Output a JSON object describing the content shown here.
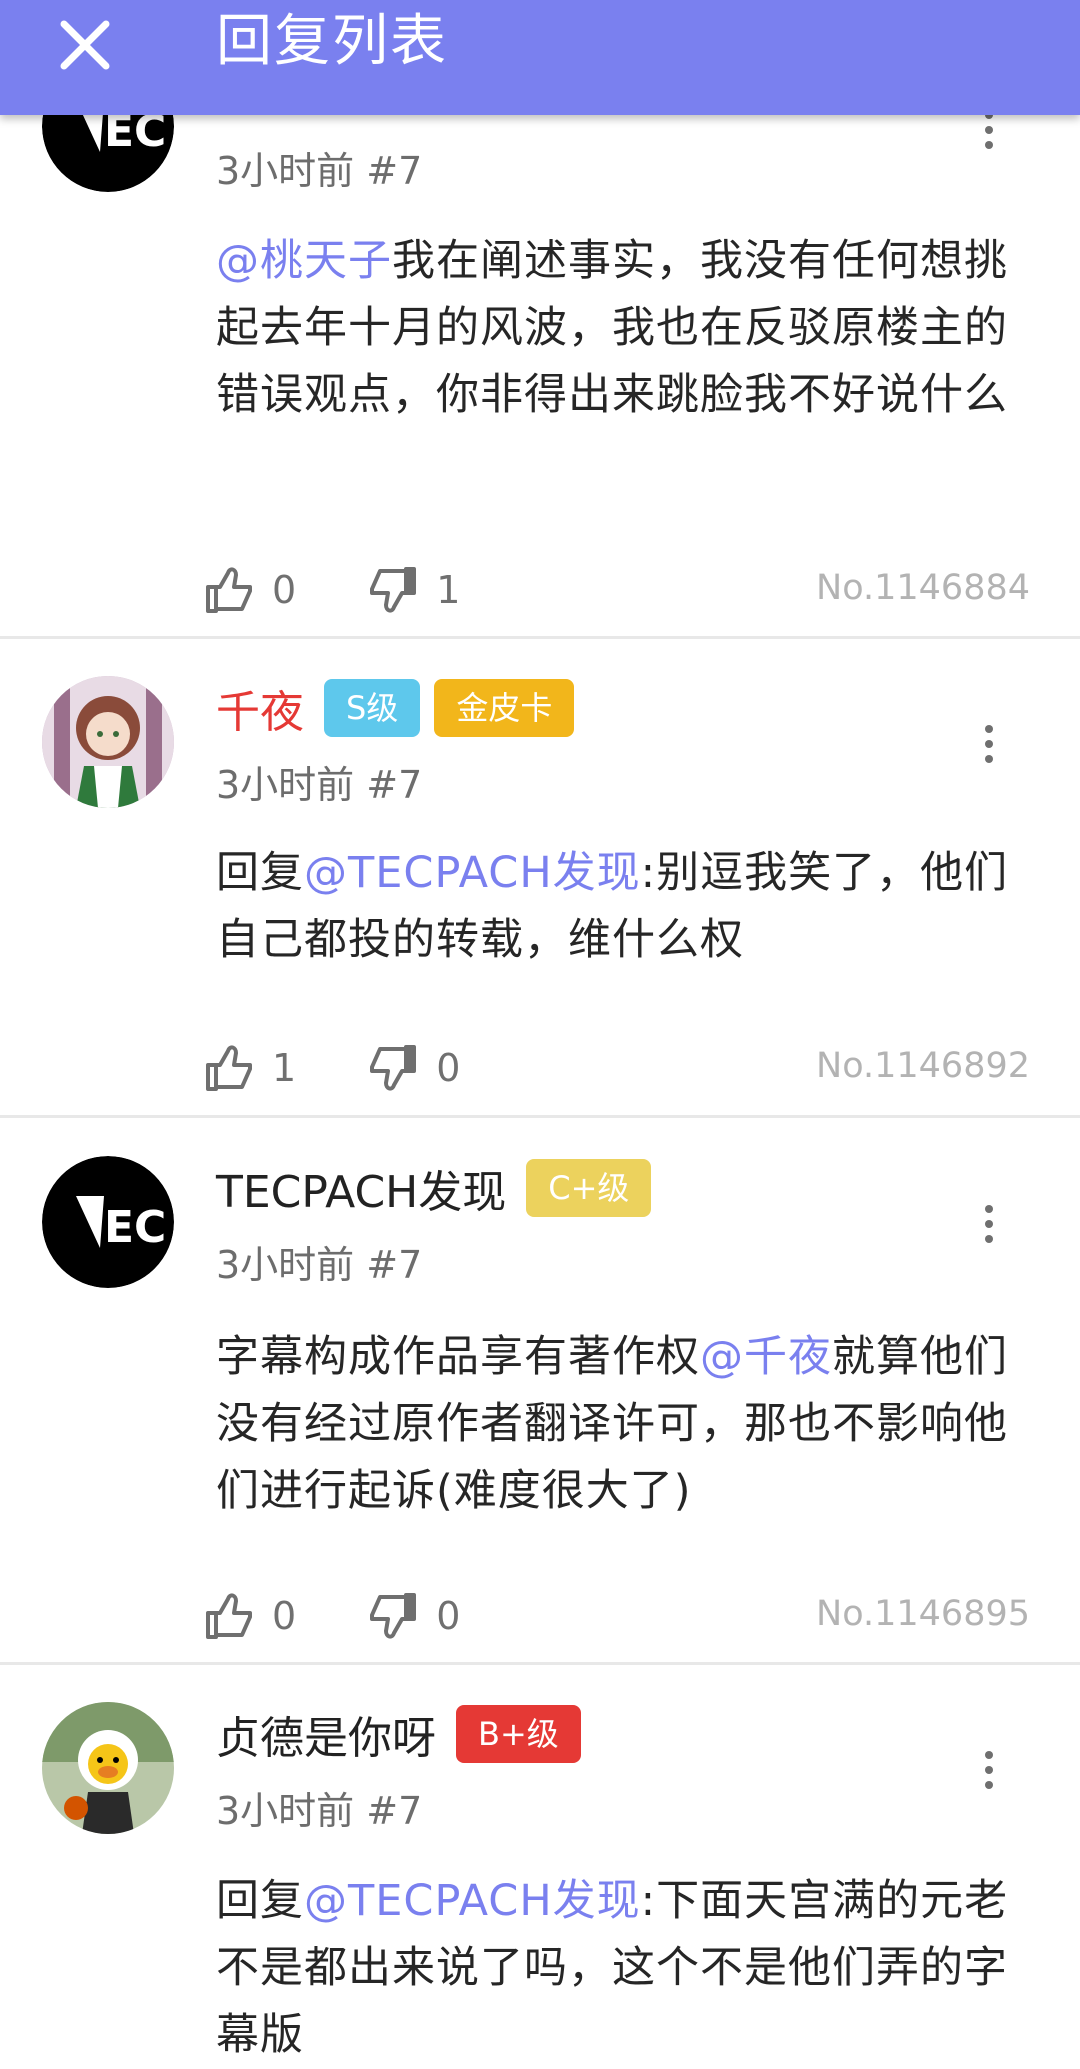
{
  "header": {
    "title": "回复列表"
  },
  "comments": [
    {
      "username": "",
      "meta": "3小时前 #7",
      "mention": "@桃天子",
      "text": "我在阐述事实，我没有任何想挑起去年十月的风波，我也在反驳原楼主的错误观点，你非得出来跳脸我不好说什么",
      "likes": "0",
      "dislikes": "1",
      "no": "No.1146884"
    },
    {
      "username": "千夜",
      "badges": [
        "S级",
        "金皮卡"
      ],
      "meta": "3小时前 #7",
      "prefix": "回复",
      "mention": "@TECPACH发现",
      "text": ":别逗我笑了，他们自己都投的转载，维什么权",
      "likes": "1",
      "dislikes": "0",
      "no": "No.1146892"
    },
    {
      "username": "TECPACH发现",
      "badges": [
        "C+级"
      ],
      "meta": "3小时前 #7",
      "text_before": "字幕构成作品享有著作权",
      "mention": "@千夜",
      "text": "就算他们没有经过原作者翻译许可，那也不影响他们进行起诉(难度很大了)",
      "likes": "0",
      "dislikes": "0",
      "no": "No.1146895"
    },
    {
      "username": "贞德是你呀",
      "badges": [
        "B+级"
      ],
      "meta": "3小时前 #7",
      "prefix": "回复",
      "mention": "@TECPACH发现",
      "text": ":下面天宫满的元老不是都出来说了吗，这个不是他们弄的字幕版"
    }
  ],
  "colors": {
    "accent": "#7a80ef",
    "badge_s": "#5ec8ec",
    "badge_gold": "#f2b61b",
    "badge_c": "#ecd25d",
    "badge_b": "#e53935",
    "username_red": "#e53935"
  },
  "icons": {
    "close": "close-icon",
    "like": "thumbs-up-icon",
    "dislike": "thumbs-down-icon",
    "more": "more-vertical-icon"
  }
}
